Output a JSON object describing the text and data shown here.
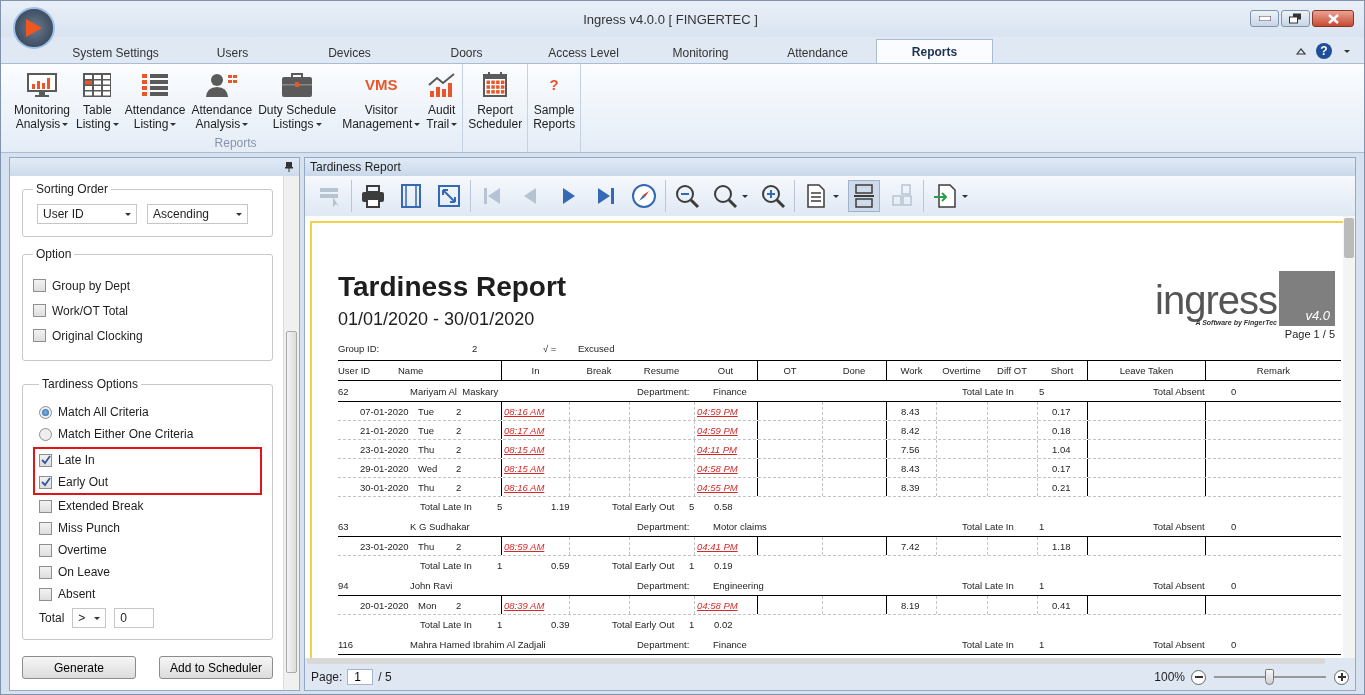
{
  "window": {
    "title": "Ingress v4.0.0 [ FINGERTEC ]",
    "help_glyph": "?"
  },
  "tabs": [
    {
      "label": "System Settings",
      "selected": false
    },
    {
      "label": "Users",
      "selected": false
    },
    {
      "label": "Devices",
      "selected": false
    },
    {
      "label": "Doors",
      "selected": false
    },
    {
      "label": "Access Level",
      "selected": false
    },
    {
      "label": "Monitoring",
      "selected": false
    },
    {
      "label": "Attendance",
      "selected": false
    },
    {
      "label": "Reports",
      "selected": true
    }
  ],
  "ribbon_groups": [
    {
      "label": "Reports",
      "items": [
        {
          "kind": "monitor",
          "lines": [
            "Monitoring",
            "Analysis"
          ],
          "dropdown": true
        },
        {
          "kind": "table",
          "lines": [
            "Table",
            "Listing"
          ],
          "dropdown": true
        },
        {
          "kind": "list",
          "lines": [
            "Attendance",
            "Listing"
          ],
          "dropdown": true
        },
        {
          "kind": "person",
          "lines": [
            "Attendance",
            "Analysis"
          ],
          "dropdown": true
        },
        {
          "kind": "briefcase",
          "lines": [
            "Duty Schedule",
            "Listings"
          ],
          "dropdown": true
        },
        {
          "kind": "text",
          "icon_text": "VMS",
          "lines": [
            "Visitor",
            "Management"
          ],
          "dropdown": true
        },
        {
          "kind": "trend",
          "lines": [
            "Audit",
            "Trail"
          ],
          "dropdown": true
        }
      ]
    },
    {
      "items": [
        {
          "kind": "calendar",
          "lines": [
            "Report",
            "Scheduler"
          ],
          "dropdown": false
        }
      ]
    },
    {
      "items": [
        {
          "kind": "text",
          "icon_text": "?",
          "lines": [
            "Sample",
            "Reports"
          ],
          "dropdown": false
        }
      ]
    }
  ],
  "sorting_order": {
    "title": "Sorting Order",
    "sort_field": "User ID",
    "direction": "Ascending"
  },
  "option": {
    "title": "Option",
    "items": [
      {
        "label": "Group by Dept",
        "checked": false
      },
      {
        "label": "Work/OT Total",
        "checked": false
      },
      {
        "label": "Original Clocking",
        "checked": false
      }
    ]
  },
  "tardiness_options": {
    "title": "Tardiness Options",
    "criteria": [
      {
        "label": "Match All Criteria",
        "selected": true
      },
      {
        "label": "Match Either One Criteria",
        "selected": false
      }
    ],
    "items": [
      {
        "label": "Late In",
        "checked": true,
        "highlighted": true
      },
      {
        "label": "Early Out",
        "checked": true,
        "highlighted": true
      },
      {
        "label": "Extended Break",
        "checked": false,
        "highlighted": false
      },
      {
        "label": "Miss Punch",
        "checked": false,
        "highlighted": false
      },
      {
        "label": "Overtime",
        "checked": false,
        "highlighted": false
      },
      {
        "label": "On Leave",
        "checked": false,
        "highlighted": false
      },
      {
        "label": "Absent",
        "checked": false,
        "highlighted": false
      }
    ],
    "total": {
      "label": "Total",
      "operator": ">",
      "value": "0"
    }
  },
  "buttons": [
    "Generate",
    "Add to Scheduler"
  ],
  "viewer": {
    "title": "Tardiness Report",
    "toolbar": [
      {
        "items": [
          {
            "kind": "select",
            "disabled": true,
            "pressed": false,
            "dropdown": false
          }
        ]
      },
      {
        "items": [
          {
            "kind": "print",
            "disabled": false,
            "pressed": false,
            "dropdown": false
          },
          {
            "kind": "page-setup",
            "disabled": false,
            "pressed": false,
            "dropdown": false
          },
          {
            "kind": "fit",
            "disabled": false,
            "pressed": false,
            "dropdown": false
          }
        ]
      },
      {
        "items": [
          {
            "kind": "first",
            "disabled": true,
            "pressed": false,
            "dropdown": false
          },
          {
            "kind": "prev",
            "disabled": true,
            "pressed": false,
            "dropdown": false
          },
          {
            "kind": "next",
            "disabled": false,
            "pressed": false,
            "dropdown": false
          },
          {
            "kind": "last",
            "disabled": false,
            "pressed": false,
            "dropdown": false
          },
          {
            "kind": "navigate",
            "disabled": false,
            "pressed": false,
            "dropdown": false
          }
        ]
      },
      {
        "items": [
          {
            "kind": "zoom-out",
            "disabled": false,
            "pressed": false,
            "dropdown": false
          },
          {
            "kind": "zoom",
            "disabled": false,
            "pressed": false,
            "dropdown": true
          },
          {
            "kind": "zoom-in",
            "disabled": false,
            "pressed": false,
            "dropdown": false
          }
        ]
      },
      {
        "items": [
          {
            "kind": "document",
            "disabled": false,
            "pressed": false,
            "dropdown": true
          },
          {
            "kind": "single-page",
            "disabled": false,
            "pressed": true,
            "dropdown": false
          },
          {
            "kind": "multi-page",
            "disabled": true,
            "pressed": false,
            "dropdown": false
          }
        ]
      },
      {
        "items": [
          {
            "kind": "export",
            "disabled": false,
            "pressed": false,
            "dropdown": true
          }
        ]
      }
    ],
    "status": {
      "page_label": "Page:",
      "page": "1",
      "page_total": "/ 5",
      "zoom": "100%",
      "level": 0.5
    }
  },
  "report": {
    "title": "Tardiness Report",
    "period": "01/01/2020 - 30/01/2020",
    "logo": {
      "wordmark": "ingress",
      "tagline": "A Software by FingerTec",
      "version": "v4.0"
    },
    "page_indicator": "Page 1 / 5",
    "group_id_label": "Group ID:",
    "group_id": "2",
    "legend_mark": "√ =",
    "legend_text": "Excused",
    "columns": [
      "User ID",
      "Name",
      "In",
      "Break",
      "Resume",
      "Out",
      "OT",
      "Done",
      "Work",
      "Overtime",
      "Diff OT",
      "Short",
      "Leave Taken",
      "Remark"
    ],
    "employees": [
      {
        "user_id": "62",
        "name": "Mariyam Al  Maskary",
        "department_label": "Department:",
        "department": "Finance",
        "late_label": "Total Late In",
        "late": "5",
        "absent_label": "Total Absent",
        "absent": "0",
        "rows": [
          {
            "date": "07-01-2020",
            "day": "Tue",
            "group": "2",
            "in": "08:16 AM",
            "out": "04:59 PM",
            "work": "8.43",
            "short": "0.17"
          },
          {
            "date": "21-01-2020",
            "day": "Tue",
            "group": "2",
            "in": "08:17 AM",
            "out": "04:59 PM",
            "work": "8.42",
            "short": "0.18"
          },
          {
            "date": "23-01-2020",
            "day": "Thu",
            "group": "2",
            "in": "08:15 AM",
            "out": "04:11 PM",
            "work": "7.56",
            "short": "1.04"
          },
          {
            "date": "29-01-2020",
            "day": "Wed",
            "group": "2",
            "in": "08:15 AM",
            "out": "04:58 PM",
            "work": "8.43",
            "short": "0.17"
          },
          {
            "date": "30-01-2020",
            "day": "Thu",
            "group": "2",
            "in": "08:16 AM",
            "out": "04:55 PM",
            "work": "8.39",
            "short": "0.21"
          }
        ],
        "summary": {
          "late_label": "Total Late In",
          "late_count": "5",
          "late_hours": "1.19",
          "early_label": "Total Early Out",
          "early_count": "5",
          "early_hours": "0.58"
        }
      },
      {
        "user_id": "63",
        "name": "K G Sudhakar",
        "department_label": "Department:",
        "department": "Motor claims",
        "late_label": "Total Late In",
        "late": "1",
        "absent_label": "Total Absent",
        "absent": "0",
        "rows": [
          {
            "date": "23-01-2020",
            "day": "Thu",
            "group": "2",
            "in": "08:59 AM",
            "out": "04:41 PM",
            "work": "7.42",
            "short": "1.18"
          }
        ],
        "summary": {
          "late_label": "Total Late In",
          "late_count": "1",
          "late_hours": "0.59",
          "early_label": "Total Early Out",
          "early_count": "1",
          "early_hours": "0.19"
        }
      },
      {
        "user_id": "94",
        "name": "John Ravi",
        "department_label": "Department:",
        "department": "Engineering",
        "late_label": "Total Late In",
        "late": "1",
        "absent_label": "Total Absent",
        "absent": "0",
        "rows": [
          {
            "date": "20-01-2020",
            "day": "Mon",
            "group": "2",
            "in": "08:39 AM",
            "out": "04:58 PM",
            "work": "8.19",
            "short": "0.41"
          }
        ],
        "summary": {
          "late_label": "Total Late In",
          "late_count": "1",
          "late_hours": "0.39",
          "early_label": "Total Early Out",
          "early_count": "1",
          "early_hours": "0.02"
        }
      },
      {
        "user_id": "116",
        "name": "Mahra Hamed Ibrahim Al Zadjali",
        "department_label": "Department:",
        "department": "Finance",
        "late_label": "Total Late In",
        "late": "1",
        "absent_label": "Total Absent",
        "absent": "0"
      }
    ]
  }
}
